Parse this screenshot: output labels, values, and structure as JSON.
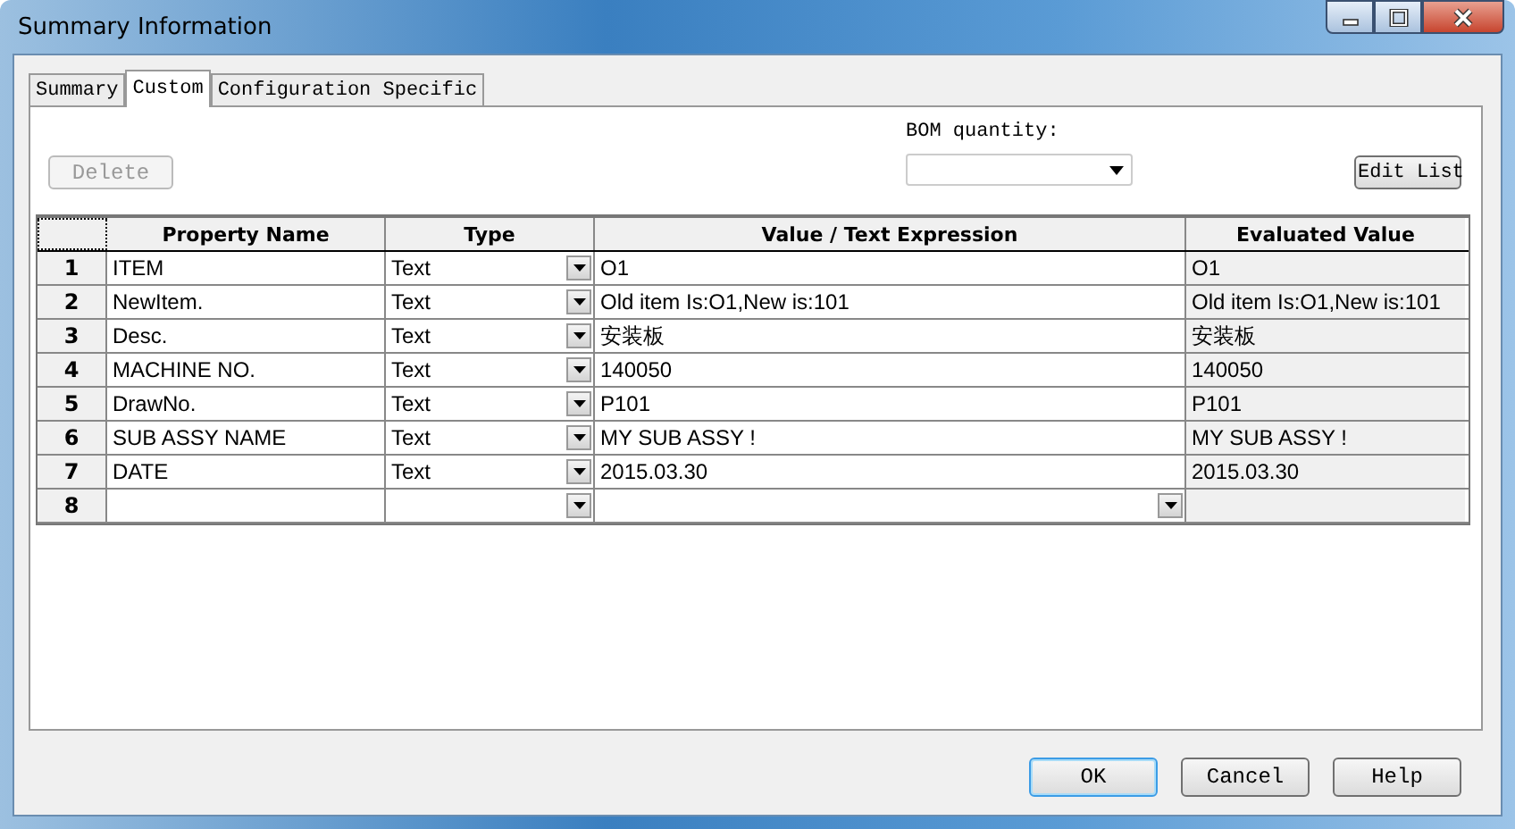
{
  "window": {
    "title": "Summary Information"
  },
  "tabs": [
    {
      "label": "Summary",
      "selected": false
    },
    {
      "label": "Custom",
      "selected": true
    },
    {
      "label": "Configuration Specific",
      "selected": false
    }
  ],
  "delete_button": {
    "label": "Delete",
    "disabled": true
  },
  "bom_quantity": {
    "label": "BOM quantity:"
  },
  "edit_list_button": {
    "label": "Edit List"
  },
  "table": {
    "columns": [
      "Property Name",
      "Type",
      "Value / Text Expression",
      "Evaluated Value"
    ],
    "rows": [
      {
        "number": "1",
        "name": "ITEM",
        "type": "Text",
        "value": "O1",
        "value_dropdown": false,
        "evaluated": "O1"
      },
      {
        "number": "2",
        "name": "NewItem.",
        "type": "Text",
        "value": "Old item Is:O1,New is:101",
        "value_dropdown": false,
        "evaluated": "Old item Is:O1,New is:101"
      },
      {
        "number": "3",
        "name": "Desc.",
        "type": "Text",
        "value": "安装板",
        "value_dropdown": false,
        "evaluated": "安装板"
      },
      {
        "number": "4",
        "name": "MACHINE NO.",
        "type": "Text",
        "value": "140050",
        "value_dropdown": false,
        "evaluated": "140050"
      },
      {
        "number": "5",
        "name": "DrawNo.",
        "type": "Text",
        "value": "P101",
        "value_dropdown": false,
        "evaluated": "P101"
      },
      {
        "number": "6",
        "name": "SUB ASSY NAME",
        "type": "Text",
        "value": "MY SUB ASSY !",
        "value_dropdown": false,
        "evaluated": "MY SUB ASSY !"
      },
      {
        "number": "7",
        "name": "DATE",
        "type": "Text",
        "value": "2015.03.30",
        "value_dropdown": false,
        "evaluated": "2015.03.30"
      },
      {
        "number": "8",
        "name": "",
        "type": "",
        "value": "",
        "value_dropdown": true,
        "evaluated": ""
      }
    ]
  },
  "buttons": [
    {
      "label": "OK",
      "default": true
    },
    {
      "label": "Cancel",
      "default": false
    },
    {
      "label": "Help",
      "default": false
    }
  ]
}
